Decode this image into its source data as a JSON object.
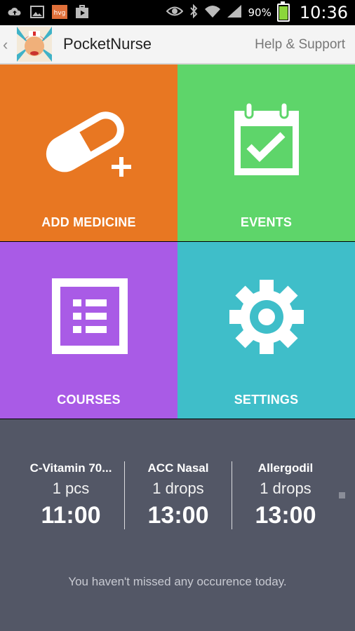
{
  "statusbar": {
    "battery_percent": "90%",
    "time": "10:36",
    "icons": [
      "cloud-upload-icon",
      "image-icon",
      "hvg-app-icon",
      "play-store-icon",
      "eye-icon",
      "bluetooth-icon",
      "wifi-icon",
      "signal-icon",
      "battery-icon"
    ]
  },
  "actionbar": {
    "title": "PocketNurse",
    "help_label": "Help & Support"
  },
  "tiles": [
    {
      "label": "ADD MEDICINE",
      "color": "#e87722"
    },
    {
      "label": "EVENTS",
      "color": "#5ed56a"
    },
    {
      "label": "COURSES",
      "color": "#a95be6"
    },
    {
      "label": "SETTINGS",
      "color": "#3fbec9"
    }
  ],
  "upcoming": [
    {
      "name": "C-Vitamin 70...",
      "dose": "1 pcs",
      "time": "11:00"
    },
    {
      "name": "ACC Nasal",
      "dose": "1 drops",
      "time": "13:00"
    },
    {
      "name": "Allergodil",
      "dose": "1 drops",
      "time": "13:00"
    }
  ],
  "empty_message": "You haven't missed any occurence today.",
  "colors": {
    "bottom_bg": "#535766",
    "actionbar_bg": "#f4f4f4"
  }
}
